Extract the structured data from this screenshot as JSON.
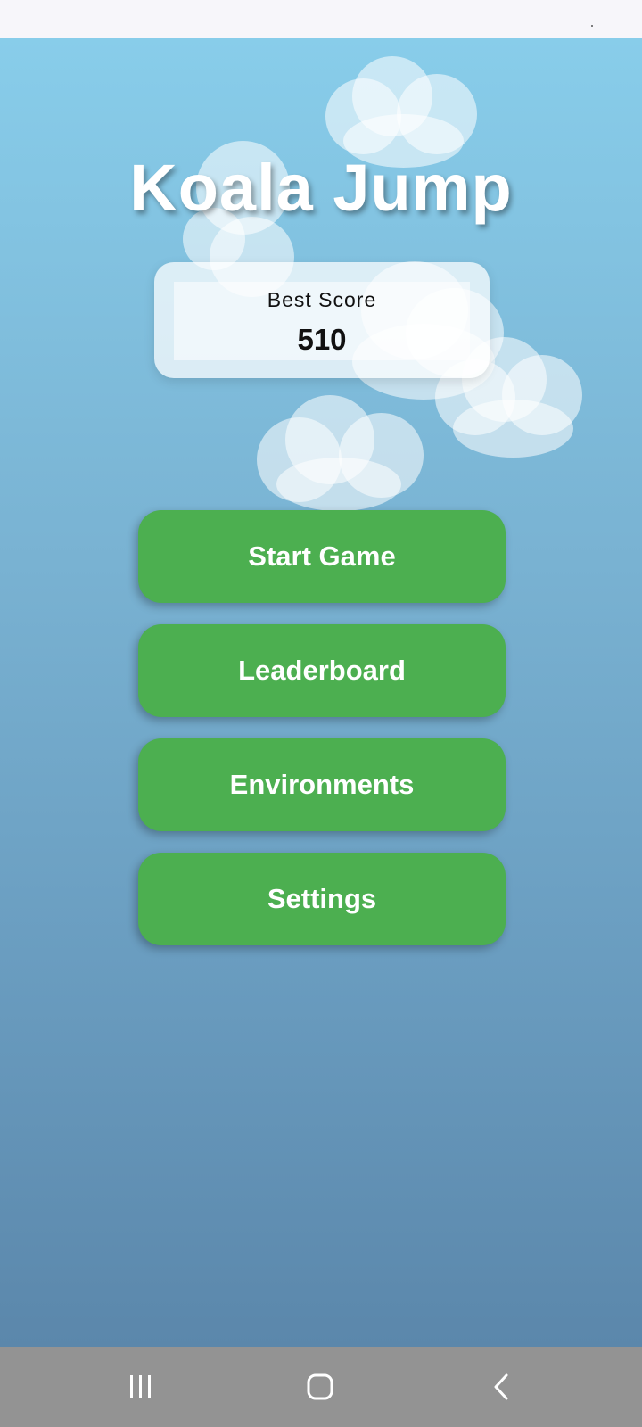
{
  "app": {
    "title": "Koala Jump"
  },
  "best_score": {
    "label": "Best Score",
    "value": "510"
  },
  "menu": {
    "start_label": "Start Game",
    "leaderboard_label": "Leaderboard",
    "environments_label": "Environments",
    "settings_label": "Settings"
  },
  "colors": {
    "sky_top": "#88cdea",
    "sky_bottom": "#5b87ab",
    "button_green": "#4caf50",
    "nav_bar": "#939393"
  },
  "system_nav": {
    "icons": [
      "recent-apps-icon",
      "home-icon",
      "back-icon"
    ]
  }
}
